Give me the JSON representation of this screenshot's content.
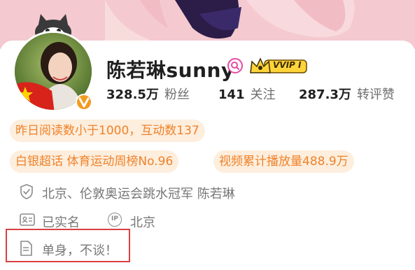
{
  "profile": {
    "name": "陈若琳sunny",
    "vip_label": "VVIP Ⅰ"
  },
  "stats": [
    {
      "value": "328.5万",
      "label": "粉丝"
    },
    {
      "value": "141",
      "label": "关注"
    },
    {
      "value": "287.3万",
      "label": "转评赞"
    }
  ],
  "tags": {
    "activity": "昨日阅读数小于1000，互动数137",
    "super_topic": "白银超话 体育运动周榜No.96",
    "video_views": "视频累计播放量488.9万"
  },
  "info": {
    "verification": "北京、伦敦奥运会跳水冠军 陈若琳",
    "real_name": "已实名",
    "ip_label": "IP",
    "ip_location": "北京",
    "bio": "单身，不谈！"
  },
  "colors": {
    "accent_orange": "#f0822a",
    "chip_bg": "#fdeedd",
    "verified_badge": "#f39a1e",
    "highlight_border": "#d94040",
    "banner_pink": "#f4c9cf"
  },
  "icons": [
    "shield-check-icon",
    "id-card-icon",
    "ip-icon",
    "document-icon",
    "verified-v-icon",
    "pink-badge-icon",
    "vvip-crown-icon"
  ]
}
